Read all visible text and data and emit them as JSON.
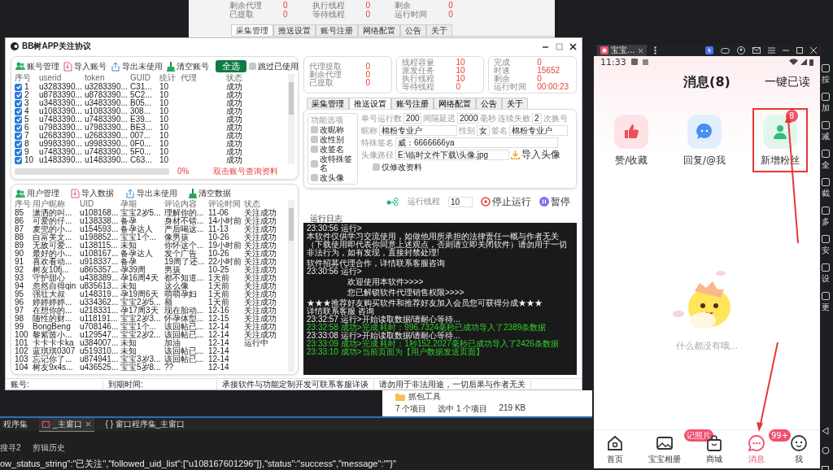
{
  "background_window": {
    "stats": [
      [
        {
          "label": "剩余代理",
          "value": "0"
        },
        {
          "label": "已提取",
          "value": "0"
        }
      ],
      [
        {
          "label": "执行线程",
          "value": "0"
        },
        {
          "label": "等待线程",
          "value": "0"
        }
      ],
      [
        {
          "label": "剩余",
          "value": "0"
        },
        {
          "label": "运行时间",
          "value": "0"
        }
      ]
    ],
    "tabs": [
      {
        "label": "采集管理",
        "selected": true
      },
      {
        "label": "推送设置",
        "selected": false
      },
      {
        "label": "账号注册",
        "selected": false
      },
      {
        "label": "网络配置",
        "selected": false
      },
      {
        "label": "公告",
        "selected": false
      },
      {
        "label": "关于",
        "selected": false
      }
    ]
  },
  "main_window": {
    "title": "BB树APP关注协议",
    "account_panel": {
      "toolbar": [
        {
          "label": "账号管理",
          "kind": "users"
        },
        {
          "label": "导入账号",
          "kind": "import"
        },
        {
          "label": "导出未使用",
          "kind": "export"
        },
        {
          "label": "清空账号",
          "kind": "clear"
        }
      ],
      "select_all": "全选",
      "skip_used": {
        "label": "跳过已使用",
        "checked": false
      },
      "columns": [
        "序号",
        "userid",
        "token",
        "GUID",
        "统计",
        "代理",
        "状态"
      ],
      "rows": [
        {
          "checked": true,
          "number": "1",
          "userid": "u3283390...",
          "token": "u3283390...",
          "guid": "C31...",
          "count": "10",
          "status": "成功"
        },
        {
          "checked": true,
          "number": "2",
          "userid": "u8783390...",
          "token": "u8783390...",
          "guid": "5C2...",
          "count": "10",
          "status": "成功"
        },
        {
          "checked": true,
          "number": "3",
          "userid": "u3483390...",
          "token": "u3483390...",
          "guid": "B05...",
          "count": "10",
          "status": "成功"
        },
        {
          "checked": true,
          "number": "4",
          "userid": "u1083390...",
          "token": "u1083390...",
          "guid": "308...",
          "count": "10",
          "status": "成功"
        },
        {
          "checked": true,
          "number": "5",
          "userid": "u7483390...",
          "token": "u7483390...",
          "guid": "E39...",
          "count": "10",
          "status": "成功"
        },
        {
          "checked": true,
          "number": "6",
          "userid": "u7983390...",
          "token": "u7983390...",
          "guid": "BE3...",
          "count": "10",
          "status": "成功"
        },
        {
          "checked": true,
          "number": "7",
          "userid": "u2683390...",
          "token": "u2683390...",
          "guid": "007...",
          "count": "10",
          "status": "成功"
        },
        {
          "checked": true,
          "number": "8",
          "userid": "u9983390...",
          "token": "u9983390...",
          "guid": "0F0...",
          "count": "10",
          "status": "成功"
        },
        {
          "checked": true,
          "number": "9",
          "userid": "u7483390...",
          "token": "u7483390...",
          "guid": "5F0...",
          "count": "10",
          "status": "成功"
        },
        {
          "checked": true,
          "number": "10",
          "userid": "u1483390...",
          "token": "u1483390...",
          "guid": "C63...",
          "count": "10",
          "status": "成功"
        }
      ],
      "progress": {
        "level": 0,
        "reading": "0%"
      },
      "hint": "双击账号查询资料"
    },
    "user_panel": {
      "toolbar": [
        {
          "label": "用户管理",
          "kind": "users"
        },
        {
          "label": "导入数据",
          "kind": "import"
        },
        {
          "label": "导出未使用",
          "kind": "export"
        },
        {
          "label": "清空数据",
          "kind": "clear"
        }
      ],
      "columns": [
        "序号",
        "用户昵称",
        "UID",
        "孕期",
        "评论内容",
        "评论时间",
        "状态"
      ],
      "rows": [
        {
          "cells": [
            "85",
            "潇洒的叫...",
            "u108168...",
            "宝宝2岁5...",
            "理解你的...",
            "11-06",
            "关注成功"
          ]
        },
        {
          "cells": [
            "86",
            "可爱的仔...",
            "u138338...",
            "备孕",
            "身材不错...",
            "14小时前",
            "关注成功"
          ]
        },
        {
          "cells": [
            "87",
            "麦兜的小...",
            "u154593...",
            "备孕达人",
            "产后喝这...",
            "11-13",
            "关注成功"
          ]
        },
        {
          "cells": [
            "88",
            "白富美文...",
            "u198852...",
            "宝宝1个...",
            "像男孩",
            "10-26",
            "关注成功"
          ]
        },
        {
          "cells": [
            "89",
            "无敌可爱...",
            "u138115...",
            "未知",
            "你怀这个...",
            "19小时前",
            "关注成功"
          ]
        },
        {
          "cells": [
            "90",
            "最好的小...",
            "u108167...",
            "备孕达人",
            "发个广告",
            "10-26",
            "关注成功"
          ]
        },
        {
          "cells": [
            "91",
            "喜欢看动...",
            "u918337...",
            "备孕",
            "19周了还...",
            "22小时前",
            "关注成功"
          ]
        },
        {
          "cells": [
            "92",
            "树友10fj...",
            "u865357...",
            "孕39周",
            "男孩",
            "10-25",
            "关注成功"
          ]
        },
        {
          "cells": [
            "93",
            "守护甜心",
            "u438389...",
            "孕16周4天",
            "都不知道...",
            "1天前",
            "关注成功"
          ]
        },
        {
          "cells": [
            "94",
            "忽然自得qin",
            "u835613...",
            "未知",
            "这么像",
            "1天前",
            "关注成功"
          ]
        },
        {
          "cells": [
            "95",
            "强壮大叔",
            "u148319...",
            "孕19周6天",
            "萌萌孕妇",
            "1天前",
            "关注成功"
          ]
        },
        {
          "cells": [
            "96",
            "婷婷婷婷...",
            "u334362...",
            "宝宝2岁5...",
            "额",
            "1天前",
            "关注成功"
          ]
        },
        {
          "cells": [
            "97",
            "在想你的...",
            "u218331...",
            "孕17周3天",
            "现在胎动...",
            "12-16",
            "关注成功"
          ]
        },
        {
          "cells": [
            "98",
            "随性的财...",
            "u118191...",
            "宝宝2岁3...",
            "怀孕体型...",
            "12-15",
            "关注成功"
          ]
        },
        {
          "cells": [
            "99",
            "BongBeng",
            "u708146...",
            "宝宝1个...",
            "该回帖已...",
            "12-14",
            "关注成功"
          ]
        },
        {
          "cells": [
            "100",
            "黎紫茵小...",
            "u129547...",
            "宝宝2岁2...",
            "该回帖已...",
            "12-14",
            "关注成功"
          ]
        },
        {
          "cells": [
            "101",
            "卡卡卡卡ka",
            "u384007...",
            "未知",
            "加油",
            "12-14",
            "运行中"
          ]
        },
        {
          "cells": [
            "102",
            "蓝琪琪0307",
            "u519310...",
            "未知",
            "该回帖已...",
            "12-14"
          ]
        },
        {
          "cells": [
            "103",
            "忘记你了...",
            "u874941...",
            "宝宝3岁3...",
            "该回帖已...",
            "12-14"
          ]
        },
        {
          "cells": [
            "104",
            "树友9x4s...",
            "u436525...",
            "宝宝5岁8...",
            "??",
            "12-14"
          ]
        }
      ]
    },
    "stats_groups": [
      [
        {
          "label": "代理提取",
          "value": "0"
        },
        {
          "label": "剩余代理",
          "value": "0"
        },
        {
          "label": "已提取",
          "value": "0"
        }
      ],
      [
        {
          "label": "线程容量",
          "value": "10"
        },
        {
          "label": "派发任务",
          "value": "10"
        },
        {
          "label": "执行线程",
          "value": "10"
        },
        {
          "label": "等待线程",
          "value": "0"
        }
      ],
      [
        {
          "label": "完成",
          "value": "0"
        },
        {
          "label": "时速",
          "value": "15652"
        },
        {
          "label": "剩余",
          "value": "0"
        },
        {
          "label": "运行时间",
          "value": "00:00:23"
        }
      ]
    ],
    "tabs": [
      {
        "label": "采集管理",
        "selected": false
      },
      {
        "label": "推送设置",
        "selected": true
      },
      {
        "label": "账号注册",
        "selected": false
      },
      {
        "label": "网络配置",
        "selected": false
      },
      {
        "label": "公告",
        "selected": false
      },
      {
        "label": "关于",
        "selected": false
      }
    ],
    "settings": {
      "options_title": "功能选项",
      "options": [
        {
          "label": "改昵称",
          "checked": false
        },
        {
          "label": "改性别",
          "checked": false
        },
        {
          "label": "改签名",
          "checked": false
        },
        {
          "label": "改特殊签名",
          "checked": false
        },
        {
          "label": "改头像",
          "checked": false
        }
      ],
      "runs_per_account": {
        "label": "单号运行数",
        "value": "200"
      },
      "interval": {
        "label": "间隔延迟",
        "value": "2000",
        "unit": "毫秒"
      },
      "failures": {
        "label": "连续失败",
        "value": "2",
        "unit": "次换号"
      },
      "nickname": {
        "label": "昵称",
        "value": "棉粉专业户"
      },
      "gender": {
        "label": "性别",
        "value": "女"
      },
      "signature": {
        "label": "签名",
        "value": "棉粉专业户"
      },
      "special_signature": {
        "label": "特殊签名",
        "value": "威：6666666ya"
      },
      "avatar_path": {
        "label": "头像路径",
        "value": "E:\\临时文件下载\\头像.jpg"
      },
      "import_avatar": "导入头像",
      "profile_only": {
        "label": "仅修改资料",
        "checked": false
      }
    },
    "run_controls": {
      "threads_label": "运行线程",
      "threads": "10",
      "stop": "停止运行",
      "pause": "暂停"
    },
    "log": {
      "title": "运行日志",
      "lines": [
        {
          "text": "23:30:56 运行>",
          "kind": "info",
          "spaced": false
        },
        {
          "text": "本软件仅供学习交流使用，如做他用所承担的法律责任一概与作者无关（下载使用即代表你同意上述观点，否则请立即关闭软件）请勿用于一切非法行为，如有发现，直接封禁处理!",
          "kind": "info",
          "spaced": false
        },
        {
          "text": "软件招募代理合作，详情联系客服咨询",
          "kind": "info",
          "spaced": true
        },
        {
          "text": "23:30:56 运行>",
          "kind": "info",
          "spaced": false
        },
        {
          "text": "欢迎使用本软件>>>>",
          "kind": "banner",
          "spaced": true
        },
        {
          "text": "您已解锁软件代理销售权限>>>>",
          "kind": "banner",
          "spaced": true
        },
        {
          "text": "★★★推荐好友购买软件和推荐好友加入会员您可获得分成★★★",
          "kind": "info",
          "spaced": true
        },
        {
          "text": "详情联系客服   咨询",
          "kind": "info",
          "spaced": false
        },
        {
          "text": "23:32:57 运行>开始读取数据/请耐心等待...",
          "kind": "info",
          "spaced": false
        },
        {
          "text": "23:32:58 成功>完成 耗时：996.7324毫秒已成功导入了2389条数据",
          "kind": "success",
          "spaced": false
        },
        {
          "text": "23:33:08 运行>开始读取数据/请耐心等待...",
          "kind": "info",
          "spaced": false
        },
        {
          "text": "23:33:09 成功>完成 耗时：1秒152.2027毫秒已成功导入了2426条数据",
          "kind": "success",
          "spaced": false
        },
        {
          "text": "23:33:10 成功>当前页面为【用户数据发送页面】",
          "kind": "success",
          "spaced": false
        }
      ]
    },
    "status_bar": [
      "账号:",
      "到期时间:",
      "承接软件与功能定制开发可联系客服详谈",
      "请勿用于非法用途，一切后果与作者无关"
    ]
  },
  "explorer": {
    "folder": "抓包工具",
    "status": [
      "7 个项目",
      "选中 1 个项目",
      "219 KB"
    ]
  },
  "ide": {
    "tabs": [
      {
        "label": "程序集",
        "selected": false
      },
      {
        "label": "_主窗口",
        "selected": true
      },
      {
        "label": "{ } 窗口程序集_主窗口",
        "selected": false
      }
    ],
    "panel_tabs": [
      "搜寻2",
      "剪辑历史"
    ],
    "output": "ow_status_string\":\"已关注\",\"followed_uid_list\":[\"u108167601296\"]},\"status\":\"success\",\"message\":\"\"}\""
  },
  "phone": {
    "tab_title": "宝宝...",
    "time": "11:33",
    "title": "消息(8)",
    "mark_all_read": "一键已读",
    "categories": [
      {
        "label": "赞/收藏",
        "kind": "like",
        "highlighted": false
      },
      {
        "label": "回复/@我",
        "kind": "reply",
        "highlighted": false
      },
      {
        "label": "新增粉丝",
        "kind": "follower",
        "badge": "8",
        "highlighted": true
      }
    ],
    "empty_text": "什么都没有哦...",
    "nav": [
      {
        "label": "首页",
        "kind": "home",
        "selected": false
      },
      {
        "label": "宝宝相册",
        "kind": "album",
        "badge": "记照片",
        "selected": false
      },
      {
        "label": "商城",
        "kind": "shop",
        "selected": false
      },
      {
        "label": "消息",
        "kind": "message",
        "badge": "99+",
        "selected": true
      },
      {
        "label": "我",
        "kind": "me",
        "selected": false
      }
    ]
  },
  "emulator_sidebar": [
    "按",
    "加",
    "减",
    "全",
    "截",
    "多",
    "安",
    "设",
    "更"
  ]
}
